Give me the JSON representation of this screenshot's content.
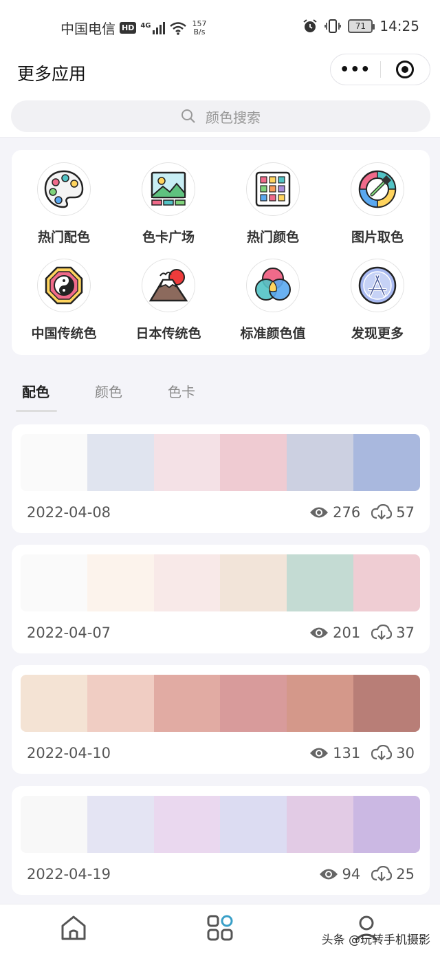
{
  "status": {
    "carrier": "中国电信",
    "hd": "HD",
    "net_type": "4G",
    "speed_value": "157",
    "speed_unit": "B/s",
    "battery": "71",
    "time": "14:25"
  },
  "header": {
    "title": "更多应用",
    "more_label": "•••",
    "search_placeholder": "颜色搜索"
  },
  "apps": [
    {
      "label": "热门配色",
      "icon": "palette-icon"
    },
    {
      "label": "色卡广场",
      "icon": "landscape-card-icon"
    },
    {
      "label": "热门颜色",
      "icon": "color-grid-icon"
    },
    {
      "label": "图片取色",
      "icon": "color-picker-icon"
    },
    {
      "label": "中国传统色",
      "icon": "yin-yang-icon"
    },
    {
      "label": "日本传统色",
      "icon": "mount-fuji-icon"
    },
    {
      "label": "标准颜色值",
      "icon": "rgb-circles-icon"
    },
    {
      "label": "发现更多",
      "icon": "app-store-icon"
    }
  ],
  "tabs": [
    "配色",
    "颜色",
    "色卡"
  ],
  "active_tab": 0,
  "palettes": [
    {
      "date": "2022-04-08",
      "views": "276",
      "downloads": "57",
      "colors": [
        "#fafafa",
        "#e0e4ef",
        "#f4e1e6",
        "#efcbd2",
        "#ccd0e1",
        "#a9b8de"
      ]
    },
    {
      "date": "2022-04-07",
      "views": "201",
      "downloads": "37",
      "colors": [
        "#fafafa",
        "#fcf3ec",
        "#f8e9e8",
        "#f2e4d9",
        "#c4dbd3",
        "#efcdd3"
      ]
    },
    {
      "date": "2022-04-10",
      "views": "131",
      "downloads": "30",
      "colors": [
        "#f4e3d4",
        "#f0cdc3",
        "#e1aba3",
        "#d89b9b",
        "#d4988a",
        "#b87e77"
      ]
    },
    {
      "date": "2022-04-19",
      "views": "94",
      "downloads": "25",
      "colors": [
        "#f8f8f8",
        "#e4e4f3",
        "#ead8ef",
        "#dcdcf2",
        "#e2cbe5",
        "#cbb8e3"
      ]
    }
  ],
  "tabbar": [
    "home-icon",
    "apps-grid-icon",
    "profile-icon"
  ],
  "watermark": "头条 @玩转手机摄影"
}
